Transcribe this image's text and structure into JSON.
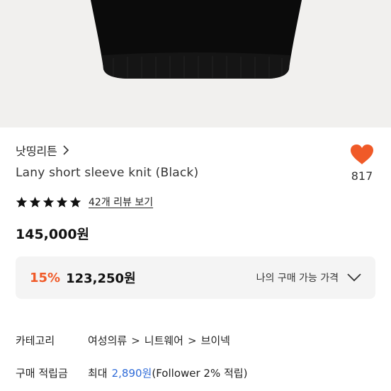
{
  "product": {
    "brand": "낫띵리튼",
    "title": "Lany short sleeve knit (Black)",
    "likes": "817",
    "review_link": "42개 리뷰 보기",
    "rating_stars": 5,
    "price": "145,000원"
  },
  "discount": {
    "percent": "15%",
    "price": "123,250원",
    "my_price_label": "나의 구매 가능 가격"
  },
  "info": {
    "category_label": "카테고리",
    "categories": [
      "여성의류",
      "니트웨어",
      "브이넥"
    ],
    "points_label": "구매 적립금",
    "points_prefix": "최대",
    "points_amount": "2,890원",
    "points_suffix": "(Follower 2% 적립)"
  },
  "colors": {
    "accent": "#f05a28",
    "heart": "#f05a28",
    "link_blue": "#2f6bd8",
    "box_bg": "#f4f4f4"
  }
}
